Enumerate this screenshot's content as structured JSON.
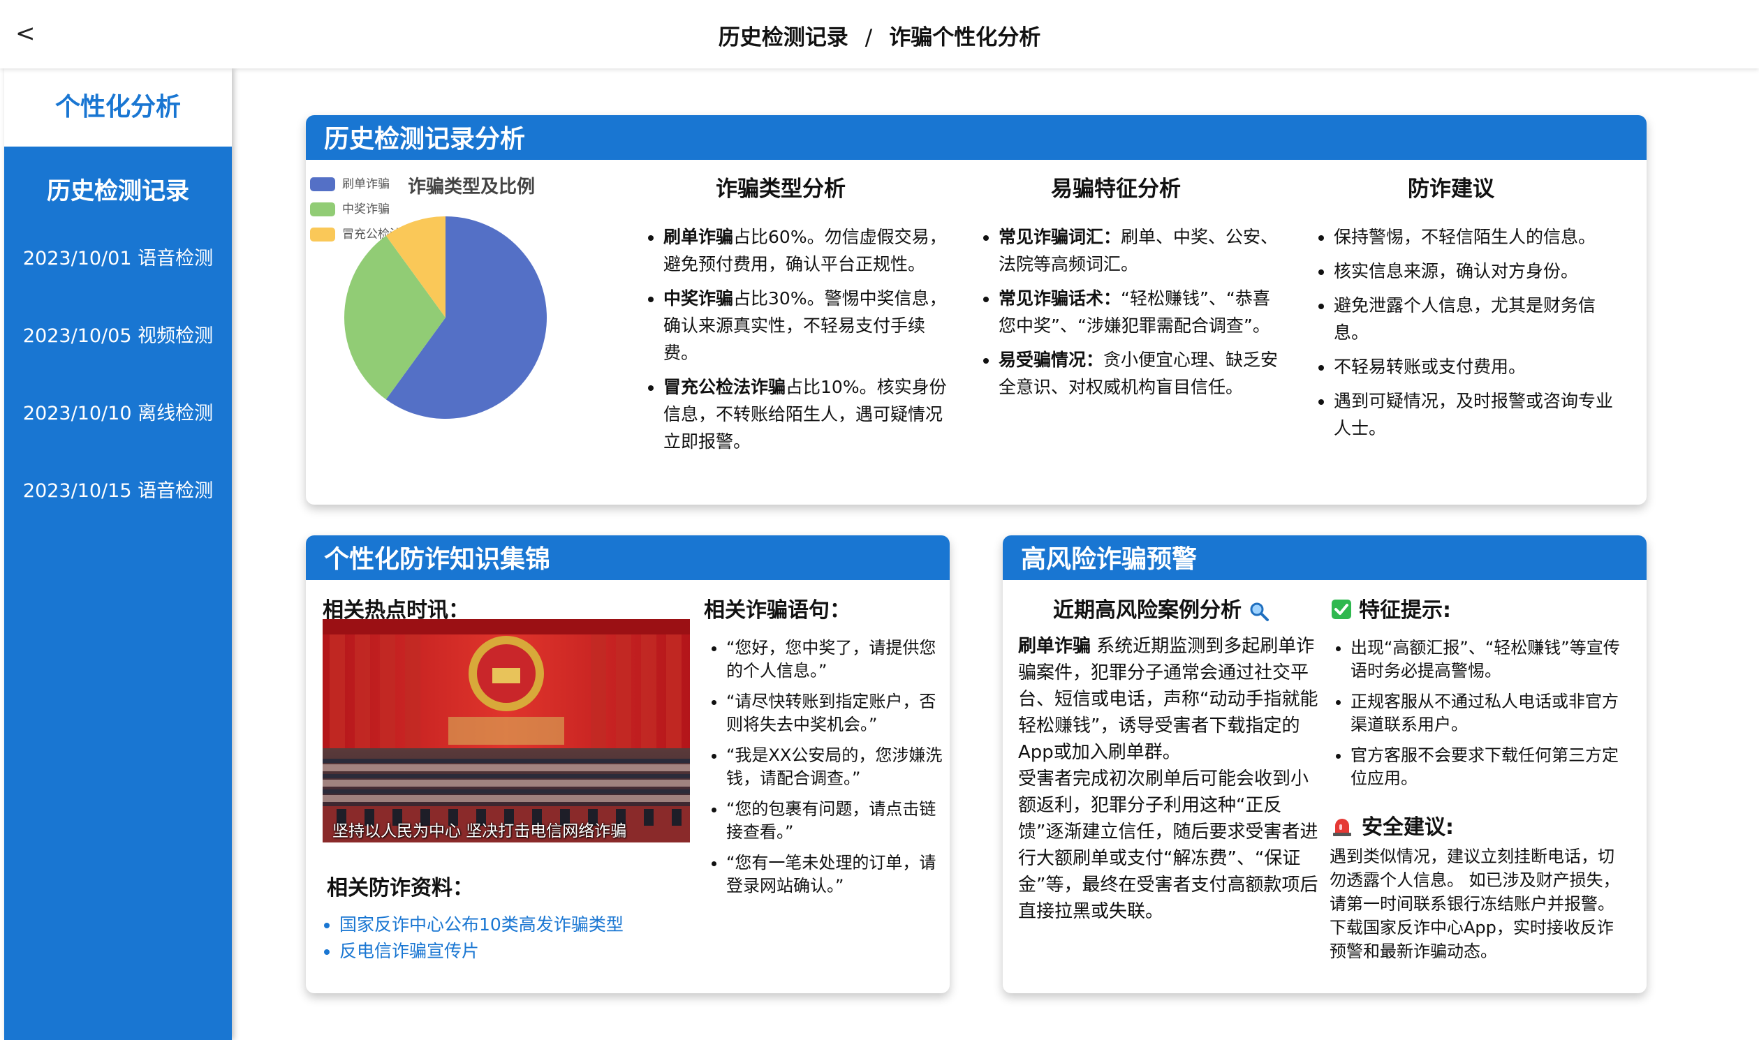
{
  "topbar": {
    "back": "<",
    "crumb1": "历史检测记录",
    "sep": "/",
    "crumb2": "诈骗个性化分析"
  },
  "sidebar": {
    "active": "个性化分析",
    "heading": "历史检测记录",
    "items": [
      "2023/10/01 语音检测",
      "2023/10/05 视频检测",
      "2023/10/10 离线检测",
      "2023/10/15 语音检测"
    ]
  },
  "analysis": {
    "header": "历史检测记录分析",
    "chart_title": "诈骗类型及比例",
    "col1_title": "诈骗类型分析",
    "col1_items": [
      {
        "b": "刷单诈骗",
        "t": "占比60%。勿信虚假交易，避免预付费用，确认平台正规性。"
      },
      {
        "b": "中奖诈骗",
        "t": "占比30%。警惕中奖信息，确认来源真实性，不轻易支付手续费。"
      },
      {
        "b": "冒充公检法诈骗",
        "t": "占比10%。核实身份信息，不转账给陌生人，遇可疑情况立即报警。"
      }
    ],
    "col2_title": "易骗特征分析",
    "col2_items": [
      {
        "b": "常见诈骗词汇：",
        "t": "刷单、中奖、公安、法院等高频词汇。"
      },
      {
        "b": "常见诈骗话术：",
        "t": "“轻松赚钱”、“恭喜您中奖”、“涉嫌犯罪需配合调查”。"
      },
      {
        "b": "易受骗情况：",
        "t": "贪小便宜心理、缺乏安全意识、对权威机构盲目信任。"
      }
    ],
    "col3_title": "防诈建议",
    "col3_items": [
      "保持警惕，不轻信陌生人的信息。",
      "核实信息来源，确认对方身份。",
      "避免泄露个人信息，尤其是财务信息。",
      "不轻易转账或支付费用。",
      "遇到可疑情况，及时报警或咨询专业人士。"
    ]
  },
  "chart_data": {
    "type": "pie",
    "title": "诈骗类型及比例",
    "categories": [
      "刷单诈骗",
      "中奖诈骗",
      "冒充公检法诈骗"
    ],
    "values": [
      60,
      30,
      10
    ],
    "colors": [
      "#5470c6",
      "#91cc75",
      "#fac858"
    ],
    "legend": "top-left"
  },
  "knowledge": {
    "header": "个性化防诈知识集锦",
    "news_title": "相关热点时讯：",
    "photo_caption": "坚持以人民为中心 坚决打击电信网络诈骗",
    "phrases_title": "相关诈骗语句：",
    "phrases": [
      "“您好，您中奖了，请提供您的个人信息。”",
      "“请尽快转账到指定账户，否则将失去中奖机会。”",
      "“我是XX公安局的，您涉嫌洗钱，请配合调查。”",
      "“您的包裹有问题，请点击链接查看。”",
      "“您有一笔未处理的订单，请登录网站确认。”"
    ],
    "materials_title": "相关防诈资料：",
    "links": [
      "国家反诈中心公布10类高发诈骗类型",
      "反电信诈骗宣传片"
    ]
  },
  "warning": {
    "header": "高风险诈骗预警",
    "case_title": "近期高风险案例分析",
    "case_icon": "magnifier-icon",
    "case_bold": "刷单诈骗",
    "case_p1": " 系统近期监测到多起刷单诈骗案件，犯罪分子通常会通过社交平台、短信或电话，声称“动动手指就能轻松赚钱”，诱导受害者下载指定的App或加入刷单群。",
    "case_p2": "受害者完成初次刷单后可能会收到小额返利，犯罪分子利用这种“正反馈”逐渐建立信任，随后要求受害者进行大额刷单或支付“解冻费”、“保证金”等，最终在受害者支付高额款项后直接拉黑或失联。",
    "feature_title": "特征提示:",
    "features": [
      "出现“高额汇报”、“轻松赚钱”等宣传语时务必提高警惕。",
      "正规客服从不通过私人电话或非官方渠道联系用户。",
      "官方客服不会要求下载任何第三方定位应用。"
    ],
    "safety_title": "安全建议:",
    "safety_text": "遇到类似情况，建议立刻挂断电话，切勿透露个人信息。 如已涉及财产损失，请第一时间联系银行冻结账户并报警。 下载国家反诈中心App，实时接收反诈预警和最新诈骗动态。"
  }
}
